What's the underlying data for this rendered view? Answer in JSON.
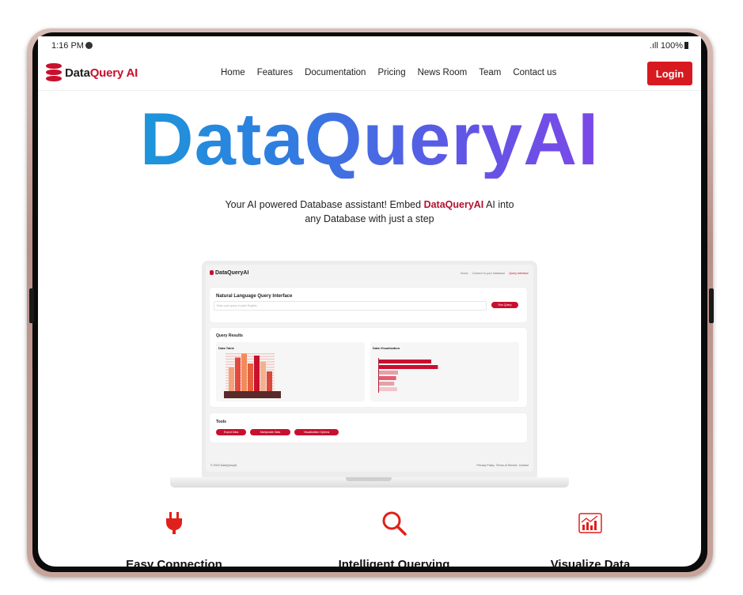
{
  "status_bar": {
    "time": "1:16 PM",
    "signal": ".ıll",
    "battery": "100%"
  },
  "nav": {
    "brand_part1": "Data",
    "brand_part2": "Query AI",
    "links": [
      "Home",
      "Features",
      "Documentation",
      "Pricing",
      "News Room",
      "Team",
      "Contact us"
    ],
    "login_label": "Login"
  },
  "hero": {
    "title": "DataQueryAI",
    "subtitle_pre": "Your AI powered Database assistant! Embed ",
    "subtitle_brand": "DataQueryAI",
    "subtitle_mid": " AI into",
    "subtitle_line2": "any Database with just a step"
  },
  "mockup": {
    "brand": "DataQueryAI",
    "nav": [
      "Home",
      "Connect to your Database",
      "Query Interface"
    ],
    "nli_title": "Natural Language Query Interface",
    "input_placeholder": "Enter your query in plain English...",
    "run_button": "Run Query",
    "results_title": "Query Results",
    "data_table_label": "Data Table",
    "data_viz_label": "Data Visualization",
    "tools_title": "Tools",
    "tools": [
      "Export Data",
      "Manipulate Data",
      "Visualization Options"
    ],
    "footer_copy": "© 2023 DataQueryAI",
    "footer_links": [
      "Privacy Policy",
      "Terms of Service",
      "Contact"
    ],
    "viz_bars": [
      0.55,
      0.62,
      0.2,
      0.18,
      0.16,
      0.19
    ],
    "table_bars": [
      0.6,
      0.85,
      0.95,
      0.7,
      0.9,
      0.75,
      0.5
    ]
  },
  "features": [
    {
      "title": "Easy Connection",
      "icon": "plug-icon"
    },
    {
      "title": "Intelligent Querying",
      "icon": "search-icon"
    },
    {
      "title": "Visualize Data",
      "icon": "chart-icon"
    }
  ],
  "colors": {
    "accent": "#d71920",
    "brand_red": "#c8102e",
    "gradient_start": "#11a7d6",
    "gradient_end": "#8e3fe8"
  }
}
